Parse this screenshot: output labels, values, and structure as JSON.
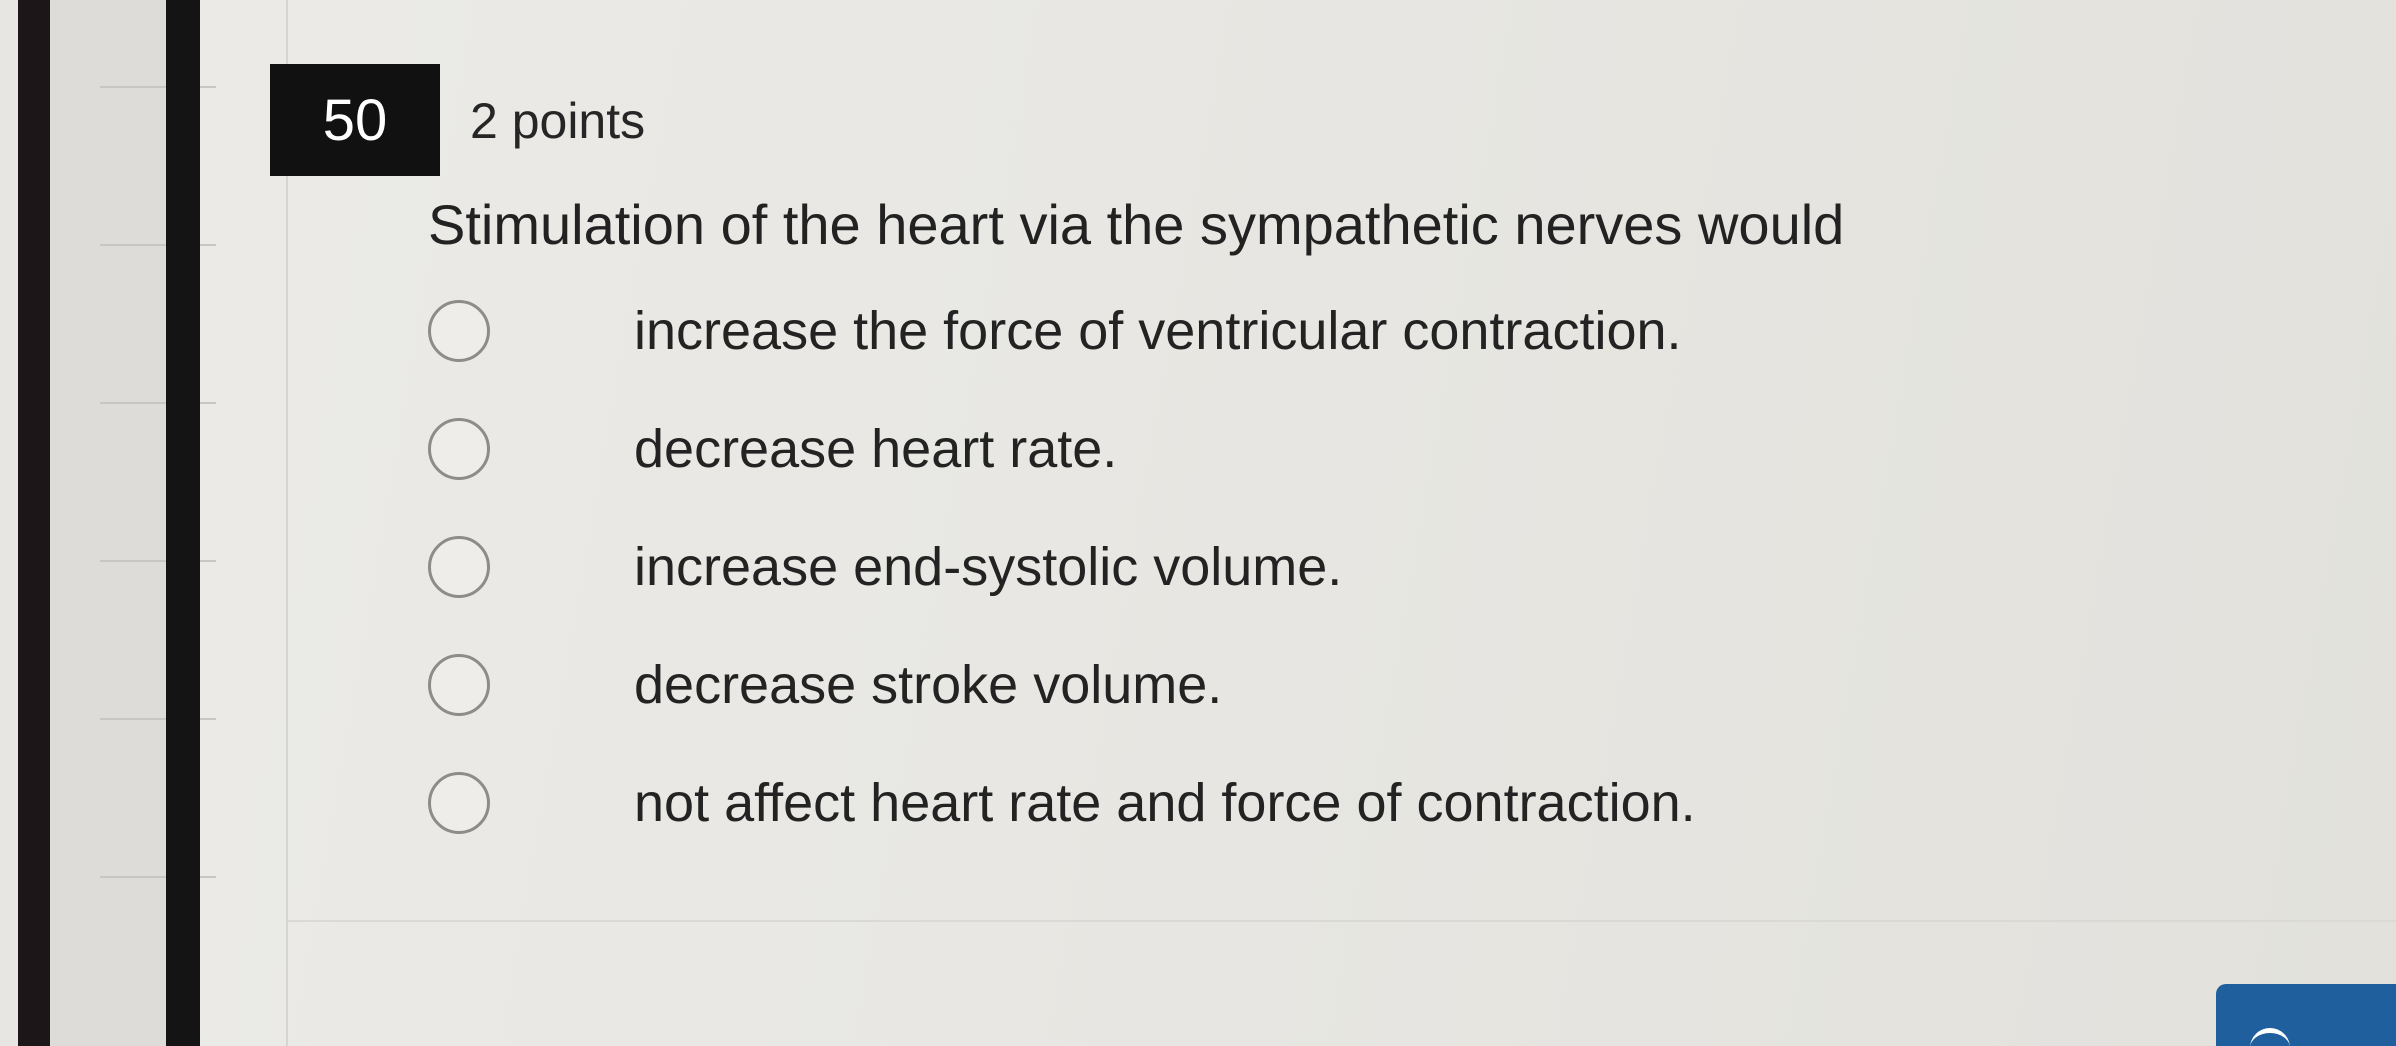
{
  "question": {
    "number": "50",
    "points": "2 points",
    "prompt": "Stimulation of the heart via the sympathetic nerves would"
  },
  "options": [
    {
      "label": "increase the force of ventricular contraction.",
      "selected": false
    },
    {
      "label": "decrease heart rate.",
      "selected": false
    },
    {
      "label": "increase end-systolic volume.",
      "selected": false
    },
    {
      "label": "decrease stroke volume.",
      "selected": false
    },
    {
      "label": "not affect heart rate and force of contraction.",
      "selected": false
    }
  ],
  "colors": {
    "background": "#e9e8e5",
    "number_badge": "#111111",
    "button": "#1f5f9e"
  }
}
